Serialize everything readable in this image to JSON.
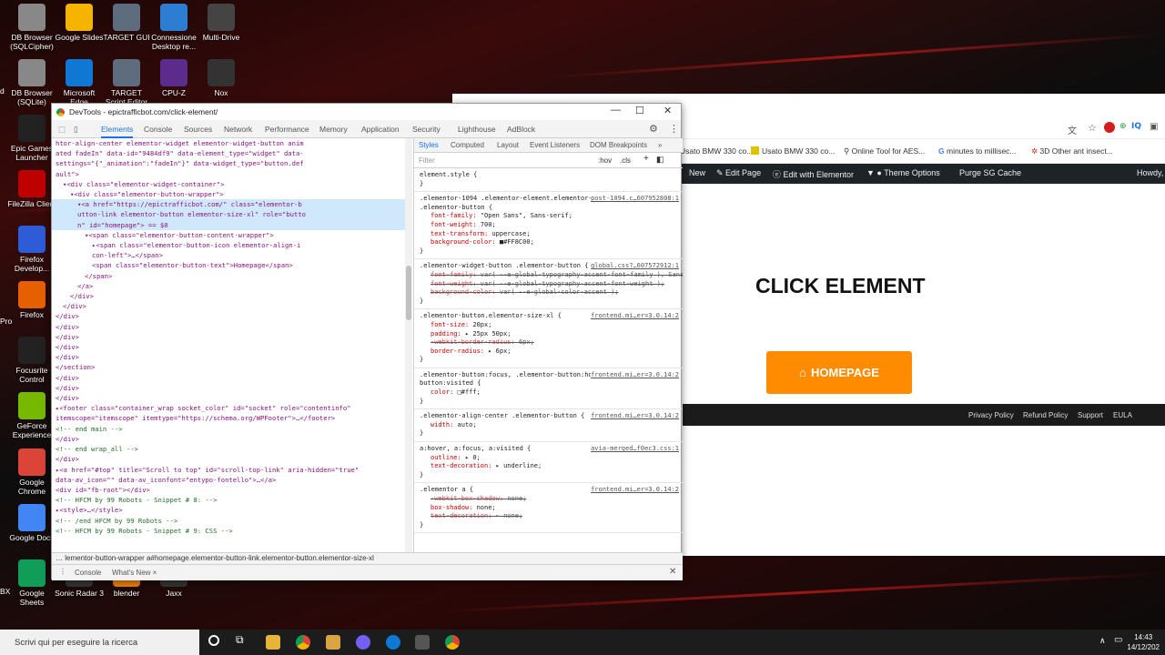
{
  "desktop": {
    "icons": [
      {
        "label": "DB Browser (SQLCipher)",
        "color": "#888888"
      },
      {
        "label": "Google Slides",
        "color": "#F4B400"
      },
      {
        "label": "TARGET GUI",
        "color": "#5d6d7e"
      },
      {
        "label": "Connessione Desktop re...",
        "color": "#2d7dd2"
      },
      {
        "label": "Multi-Drive",
        "color": "#444444"
      },
      {
        "label": "DB Browser (SQLite)",
        "color": "#888888"
      },
      {
        "label": "Microsoft Edge",
        "color": "#0f78d4"
      },
      {
        "label": "TARGET Script Editor",
        "color": "#5d6d7e"
      },
      {
        "label": "CPU-Z",
        "color": "#5b2c8c"
      },
      {
        "label": "Nox",
        "color": "#333333"
      },
      {
        "label": "Epic Games Launcher",
        "color": "#222222"
      },
      {
        "label": "FileZilla Client",
        "color": "#bf0000"
      },
      {
        "label": "Firefox Develop...",
        "color": "#2e5cd6"
      },
      {
        "label": "Firefox",
        "color": "#e66000"
      },
      {
        "label": "Focusrite Control",
        "color": "#222222"
      },
      {
        "label": "GeForce Experience",
        "color": "#76b900"
      },
      {
        "label": "Google Chrome",
        "color": "#db4437"
      },
      {
        "label": "Google Docs",
        "color": "#4285f4"
      },
      {
        "label": "Google Sheets",
        "color": "#0f9d58"
      },
      {
        "label": "Sonic Radar 3",
        "color": "#333333"
      },
      {
        "label": "blender",
        "color": "#e87d0d"
      },
      {
        "label": "Jaxx",
        "color": "#333333"
      }
    ],
    "edge_labels": [
      "Pro",
      "BX",
      "d"
    ]
  },
  "browser": {
    "bookmarks": [
      "Usato BMW 330 co...",
      "Usato BMW 330 co...",
      "Online Tool for AES...",
      "minutes to millisec...",
      "3D Other ant insect..."
    ],
    "wp_bar": [
      "New",
      "Edit Page",
      "Edit with Elementor",
      "Theme Options",
      "Purge SG Cache",
      "Howdy,"
    ],
    "page_title": "CLICK ELEMENT",
    "button_label": "HOMEPAGE",
    "footer_links": [
      "Privacy Policy",
      "Refund Policy",
      "Support",
      "EULA"
    ]
  },
  "devtools": {
    "title": "DevTools - epictrafficbot.com/click-element/",
    "tabs": [
      "Elements",
      "Console",
      "Sources",
      "Network",
      "Performance",
      "Memory",
      "Application",
      "Security",
      "Lighthouse",
      "AdBlock"
    ],
    "active_tab": "Elements",
    "code_lines": [
      {
        "indent": 0,
        "html": "htor-align-center elementor-widget elementor-widget-button anim"
      },
      {
        "indent": 0,
        "html": "ated fadeIn\" data-id=\"9484df9\" data-element_type=\"widget\" data-"
      },
      {
        "indent": 0,
        "html": "settings=\"{\"_animation\":\"fadeIn\"}\" data-widget_type=\"button.def"
      },
      {
        "indent": 0,
        "html": "ault\">"
      },
      {
        "indent": 1,
        "html": "▾<div class=\"elementor-widget-container\">"
      },
      {
        "indent": 2,
        "html": "▾<div class=\"elementor-button-wrapper\">"
      },
      {
        "indent": 3,
        "html": "▾<a href=\"https://epictrafficbot.com/\" class=\"elementor-b"
      },
      {
        "indent": 3,
        "html": "utton-link elementor-button elementor-size-xl\" role=\"butto"
      },
      {
        "indent": 3,
        "html": "n\" id=\"homepage\"> == $0"
      },
      {
        "indent": 4,
        "html": "▾<span class=\"elementor-button-content-wrapper\">"
      },
      {
        "indent": 5,
        "html": "▸<span class=\"elementor-button-icon elementor-align-i"
      },
      {
        "indent": 5,
        "html": "con-left\">…</span>"
      },
      {
        "indent": 5,
        "html": "<span class=\"elementor-button-text\">Homepage</span>"
      },
      {
        "indent": 4,
        "html": "</span>"
      },
      {
        "indent": 3,
        "html": "</a>"
      },
      {
        "indent": 2,
        "html": "</div>"
      },
      {
        "indent": 1,
        "html": "</div>"
      },
      {
        "indent": 0,
        "html": "</div>"
      },
      {
        "indent": 0,
        "html": "</div>"
      },
      {
        "indent": 0,
        "html": "</div>"
      },
      {
        "indent": 0,
        "html": "</div>"
      },
      {
        "indent": 0,
        "html": "</div>"
      },
      {
        "indent": 0,
        "html": "</section>"
      },
      {
        "indent": 0,
        "html": "</div>"
      },
      {
        "indent": 0,
        "html": "</div>"
      },
      {
        "indent": 0,
        "html": "</div>"
      },
      {
        "indent": 0,
        "html": "▸<footer class=\"container_wrap socket_color\" id=\"socket\" role=\"contentinfo\""
      },
      {
        "indent": 0,
        "html": "itemscope=\"itemscope\" itemtype=\"https://schema.org/WPFooter\">…</footer>"
      },
      {
        "indent": 0,
        "html": "<!-- end main -->"
      },
      {
        "indent": 0,
        "html": "</div>"
      },
      {
        "indent": 0,
        "html": "<!-- end wrap_all -->"
      },
      {
        "indent": 0,
        "html": "</div>"
      },
      {
        "indent": 0,
        "html": "▸<a href=\"#top\" title=\"Scroll to top\" id=\"scroll-top-link\" aria-hidden=\"true\""
      },
      {
        "indent": 0,
        "html": "data-av_icon=\"\" data-av_iconfont=\"entypo-fontello\">…</a>"
      },
      {
        "indent": 0,
        "html": "<div id=\"fb-root\"></div>"
      },
      {
        "indent": 0,
        "html": "<!-- HFCM by 99 Robots - Snippet # 8:  -->"
      },
      {
        "indent": 0,
        "html": "▸<style>…</style>"
      },
      {
        "indent": 0,
        "html": "<!-- /end HFCM by 99 Robots -->"
      },
      {
        "indent": 0,
        "html": "<!-- HFCM by 99 Robots - Snippet # 9: CSS -->"
      }
    ],
    "styles_tabs": [
      "Styles",
      "Computed",
      "Layout",
      "Event Listeners",
      "DOM Breakpoints",
      "»"
    ],
    "filter_placeholder": "Filter",
    "filter_tools": [
      ":hov",
      ".cls",
      "+"
    ],
    "rules": [
      {
        "selector": "element.style {",
        "source": "",
        "props": []
      },
      {
        "selector": ".elementor-1094 .elementor-element.elementor-element-9484df9 .elementor-button {",
        "source": "post-1094.c…607952808:1",
        "props": [
          {
            "n": "font-family",
            "v": "\"Open Sans\", Sans-serif;",
            "s": false
          },
          {
            "n": "font-weight",
            "v": "700;",
            "s": false
          },
          {
            "n": "text-transform",
            "v": "uppercase;",
            "s": false
          },
          {
            "n": "background-color",
            "v": "■#FF8C00;",
            "s": false
          }
        ]
      },
      {
        "selector": ".elementor-widget-button .elementor-button {",
        "source": "global.css?…607572912:1",
        "props": [
          {
            "n": "font-family",
            "v": "var( --e-global-typography-accent-font-family ), Sans-serif;",
            "s": true
          },
          {
            "n": "font-weight",
            "v": "var( --e-global-typography-accent-font-weight );",
            "s": true
          },
          {
            "n": "background-color",
            "v": "var( --e-global-color-accent );",
            "s": true
          }
        ]
      },
      {
        "selector": ".elementor-button.elementor-size-xl {",
        "source": "frontend.mi…er=3.0.14:2",
        "props": [
          {
            "n": "font-size",
            "v": "20px;",
            "s": false
          },
          {
            "n": "padding",
            "v": "▸ 25px 50px;",
            "s": false
          },
          {
            "n": "-webkit-border-radius",
            "v": "6px;",
            "s": true
          },
          {
            "n": "border-radius",
            "v": "▸ 6px;",
            "s": false
          }
        ]
      },
      {
        "selector": ".elementor-button:focus, .elementor-button:hover, .elementor-button:visited {",
        "source": "frontend.mi…er=3.0.14:2",
        "props": [
          {
            "n": "color",
            "v": "□#fff;",
            "s": false
          }
        ]
      },
      {
        "selector": ".elementor-align-center .elementor-button {",
        "source": "frontend.mi…er=3.0.14:2",
        "props": [
          {
            "n": "width",
            "v": "auto;",
            "s": false
          }
        ]
      },
      {
        "selector": "a:hover, a:focus, a:visited {",
        "source": "avia-merged…f0ec3.css:1",
        "props": [
          {
            "n": "outline",
            "v": "▸ 0;",
            "s": false
          },
          {
            "n": "text-decoration",
            "v": "▸ underline;",
            "s": false
          }
        ]
      },
      {
        "selector": ".elementor a {",
        "source": "frontend.mi…er=3.0.14:2",
        "props": [
          {
            "n": "-webkit-box-shadow",
            "v": "none;",
            "s": true
          },
          {
            "n": "box-shadow",
            "v": "none;",
            "s": false
          },
          {
            "n": "text-decoration",
            "v": "▸ none;",
            "s": true
          }
        ]
      }
    ],
    "breadcrumbs": "…  lementor-button-wrapper    a#homepage.elementor-button-link.elementor-button.elementor-size-xl",
    "drawer_tabs": [
      "Console",
      "What's New ×"
    ]
  },
  "taskbar": {
    "search_placeholder": "Scrivi qui per eseguire la ricerca",
    "time": "14:43",
    "date": "14/12/202"
  }
}
